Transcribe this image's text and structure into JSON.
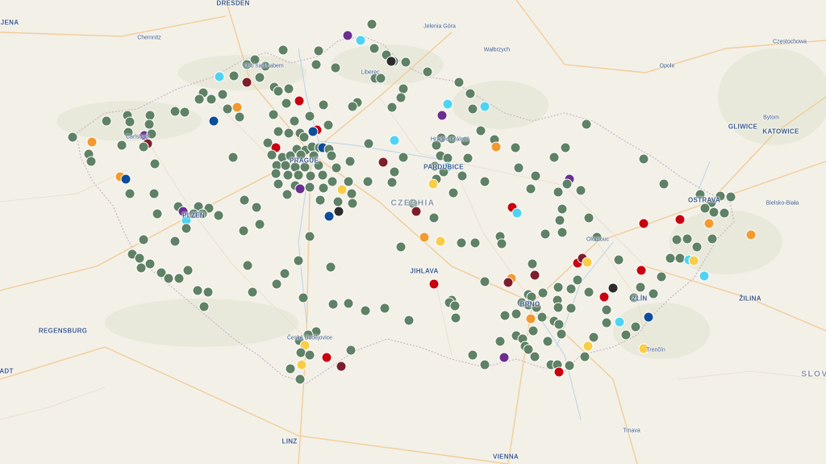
{
  "colors": {
    "green": "#5f8165",
    "red": "#c8000f",
    "darkred": "#7e1e2a",
    "blue": "#0d4d9a",
    "purple": "#6b2e8e",
    "cyan": "#4fd3f2",
    "orange": "#f29a2e",
    "yellow": "#f9cd45",
    "black": "#2c2c2c"
  },
  "labels": [
    {
      "text": "DRESDEN",
      "cls": "mid"
    },
    {
      "text": "JENA",
      "cls": "mid"
    },
    {
      "text": "Chemnitz",
      "cls": "small"
    },
    {
      "text": "Ústí nad Labem",
      "cls": "small"
    },
    {
      "text": "Liberec",
      "cls": "small"
    },
    {
      "text": "Jelenia Góra",
      "cls": "small"
    },
    {
      "text": "Wałbrzych",
      "cls": "small"
    },
    {
      "text": "Częstochowa",
      "cls": "small"
    },
    {
      "text": "Opole",
      "cls": "small"
    },
    {
      "text": "GLIWICE",
      "cls": "mid"
    },
    {
      "text": "Bytom",
      "cls": "small"
    },
    {
      "text": "KATOWICE",
      "cls": "mid"
    },
    {
      "text": "Hradec Králové",
      "cls": "small"
    },
    {
      "text": "Carlsbad",
      "cls": "small"
    },
    {
      "text": "PRAGUE",
      "cls": "mid"
    },
    {
      "text": "PARDUBICE",
      "cls": "mid"
    },
    {
      "text": "CZECHIA",
      "cls": "country"
    },
    {
      "text": "OSTRAVA",
      "cls": "mid"
    },
    {
      "text": "Bielsko-Biała",
      "cls": "small"
    },
    {
      "text": "PLZEŇ",
      "cls": "mid"
    },
    {
      "text": "Olomouc",
      "cls": "small"
    },
    {
      "text": "JIHLAVA",
      "cls": "mid"
    },
    {
      "text": "BRNO",
      "cls": "mid"
    },
    {
      "text": "ZLÍN",
      "cls": "mid"
    },
    {
      "text": "ŽILINA",
      "cls": "mid"
    },
    {
      "text": "REGENSBURG",
      "cls": "mid"
    },
    {
      "text": "České Budějovice",
      "cls": "small"
    },
    {
      "text": "Trenčín",
      "cls": "small"
    },
    {
      "text": "ADT",
      "cls": "mid"
    },
    {
      "text": "SLOV",
      "cls": "country"
    },
    {
      "text": "LINZ",
      "cls": "mid"
    },
    {
      "text": "Trnava",
      "cls": "small"
    },
    {
      "text": "VIENNA",
      "cls": "mid"
    }
  ]
}
